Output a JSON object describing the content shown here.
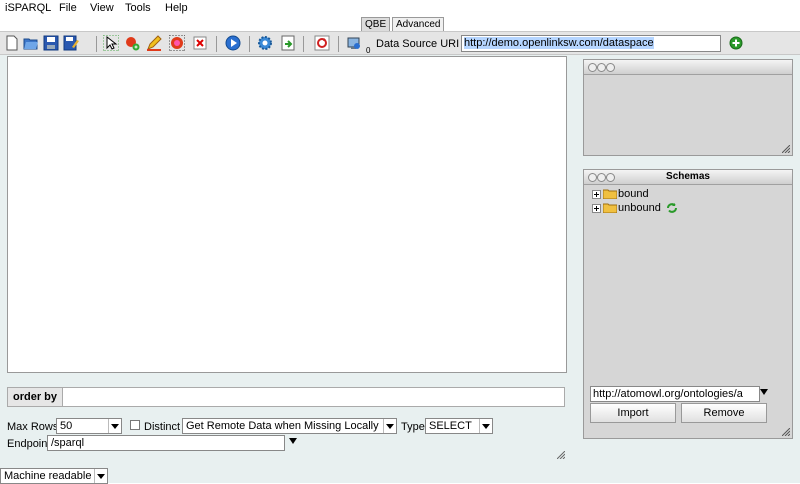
{
  "menu": {
    "app": "iSPARQL",
    "items": [
      "File",
      "View",
      "Tools",
      "Help"
    ]
  },
  "tabs": [
    {
      "label": "QBE",
      "active": true
    },
    {
      "label": "Advanced",
      "active": false
    }
  ],
  "toolbar": {
    "data_source_label": "Data Source URI",
    "data_source_value": "http://demo.openlinksw.com/dataspace",
    "connection_count": "0"
  },
  "query": {
    "order_by_label": "order by",
    "max_rows_label": "Max Rows",
    "max_rows_value": "50",
    "distinct_label": "Distinct",
    "fetch_mode_value": "Get Remote Data when Missing Locally",
    "type_label": "Type",
    "type_value": "SELECT",
    "endpoint_label": "Endpoint",
    "endpoint_value": "/sparql"
  },
  "output": {
    "format_value": "Machine readable"
  },
  "schemas_panel": {
    "title": "Schemas",
    "items": [
      {
        "label": "bound"
      },
      {
        "label": "unbound"
      }
    ],
    "uri_value": "http://atomowl.org/ontologies/a",
    "import_label": "Import",
    "remove_label": "Remove"
  },
  "colors": {
    "toolbar_bg": "#e5e5e5",
    "panel_bg": "#d6d6d6",
    "selection": "#b5d5ff",
    "add_green": "#2a9a2a"
  }
}
